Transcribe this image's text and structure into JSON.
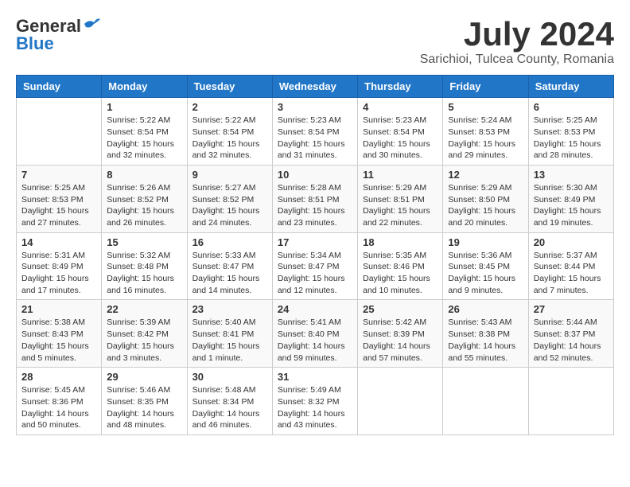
{
  "header": {
    "logo_general": "General",
    "logo_blue": "Blue",
    "month_title": "July 2024",
    "location": "Sarichioi, Tulcea County, Romania"
  },
  "days_of_week": [
    "Sunday",
    "Monday",
    "Tuesday",
    "Wednesday",
    "Thursday",
    "Friday",
    "Saturday"
  ],
  "weeks": [
    [
      {
        "day": "",
        "info": ""
      },
      {
        "day": "1",
        "info": "Sunrise: 5:22 AM\nSunset: 8:54 PM\nDaylight: 15 hours\nand 32 minutes."
      },
      {
        "day": "2",
        "info": "Sunrise: 5:22 AM\nSunset: 8:54 PM\nDaylight: 15 hours\nand 32 minutes."
      },
      {
        "day": "3",
        "info": "Sunrise: 5:23 AM\nSunset: 8:54 PM\nDaylight: 15 hours\nand 31 minutes."
      },
      {
        "day": "4",
        "info": "Sunrise: 5:23 AM\nSunset: 8:54 PM\nDaylight: 15 hours\nand 30 minutes."
      },
      {
        "day": "5",
        "info": "Sunrise: 5:24 AM\nSunset: 8:53 PM\nDaylight: 15 hours\nand 29 minutes."
      },
      {
        "day": "6",
        "info": "Sunrise: 5:25 AM\nSunset: 8:53 PM\nDaylight: 15 hours\nand 28 minutes."
      }
    ],
    [
      {
        "day": "7",
        "info": "Sunrise: 5:25 AM\nSunset: 8:53 PM\nDaylight: 15 hours\nand 27 minutes."
      },
      {
        "day": "8",
        "info": "Sunrise: 5:26 AM\nSunset: 8:52 PM\nDaylight: 15 hours\nand 26 minutes."
      },
      {
        "day": "9",
        "info": "Sunrise: 5:27 AM\nSunset: 8:52 PM\nDaylight: 15 hours\nand 24 minutes."
      },
      {
        "day": "10",
        "info": "Sunrise: 5:28 AM\nSunset: 8:51 PM\nDaylight: 15 hours\nand 23 minutes."
      },
      {
        "day": "11",
        "info": "Sunrise: 5:29 AM\nSunset: 8:51 PM\nDaylight: 15 hours\nand 22 minutes."
      },
      {
        "day": "12",
        "info": "Sunrise: 5:29 AM\nSunset: 8:50 PM\nDaylight: 15 hours\nand 20 minutes."
      },
      {
        "day": "13",
        "info": "Sunrise: 5:30 AM\nSunset: 8:49 PM\nDaylight: 15 hours\nand 19 minutes."
      }
    ],
    [
      {
        "day": "14",
        "info": "Sunrise: 5:31 AM\nSunset: 8:49 PM\nDaylight: 15 hours\nand 17 minutes."
      },
      {
        "day": "15",
        "info": "Sunrise: 5:32 AM\nSunset: 8:48 PM\nDaylight: 15 hours\nand 16 minutes."
      },
      {
        "day": "16",
        "info": "Sunrise: 5:33 AM\nSunset: 8:47 PM\nDaylight: 15 hours\nand 14 minutes."
      },
      {
        "day": "17",
        "info": "Sunrise: 5:34 AM\nSunset: 8:47 PM\nDaylight: 15 hours\nand 12 minutes."
      },
      {
        "day": "18",
        "info": "Sunrise: 5:35 AM\nSunset: 8:46 PM\nDaylight: 15 hours\nand 10 minutes."
      },
      {
        "day": "19",
        "info": "Sunrise: 5:36 AM\nSunset: 8:45 PM\nDaylight: 15 hours\nand 9 minutes."
      },
      {
        "day": "20",
        "info": "Sunrise: 5:37 AM\nSunset: 8:44 PM\nDaylight: 15 hours\nand 7 minutes."
      }
    ],
    [
      {
        "day": "21",
        "info": "Sunrise: 5:38 AM\nSunset: 8:43 PM\nDaylight: 15 hours\nand 5 minutes."
      },
      {
        "day": "22",
        "info": "Sunrise: 5:39 AM\nSunset: 8:42 PM\nDaylight: 15 hours\nand 3 minutes."
      },
      {
        "day": "23",
        "info": "Sunrise: 5:40 AM\nSunset: 8:41 PM\nDaylight: 15 hours\nand 1 minute."
      },
      {
        "day": "24",
        "info": "Sunrise: 5:41 AM\nSunset: 8:40 PM\nDaylight: 14 hours\nand 59 minutes."
      },
      {
        "day": "25",
        "info": "Sunrise: 5:42 AM\nSunset: 8:39 PM\nDaylight: 14 hours\nand 57 minutes."
      },
      {
        "day": "26",
        "info": "Sunrise: 5:43 AM\nSunset: 8:38 PM\nDaylight: 14 hours\nand 55 minutes."
      },
      {
        "day": "27",
        "info": "Sunrise: 5:44 AM\nSunset: 8:37 PM\nDaylight: 14 hours\nand 52 minutes."
      }
    ],
    [
      {
        "day": "28",
        "info": "Sunrise: 5:45 AM\nSunset: 8:36 PM\nDaylight: 14 hours\nand 50 minutes."
      },
      {
        "day": "29",
        "info": "Sunrise: 5:46 AM\nSunset: 8:35 PM\nDaylight: 14 hours\nand 48 minutes."
      },
      {
        "day": "30",
        "info": "Sunrise: 5:48 AM\nSunset: 8:34 PM\nDaylight: 14 hours\nand 46 minutes."
      },
      {
        "day": "31",
        "info": "Sunrise: 5:49 AM\nSunset: 8:32 PM\nDaylight: 14 hours\nand 43 minutes."
      },
      {
        "day": "",
        "info": ""
      },
      {
        "day": "",
        "info": ""
      },
      {
        "day": "",
        "info": ""
      }
    ]
  ]
}
